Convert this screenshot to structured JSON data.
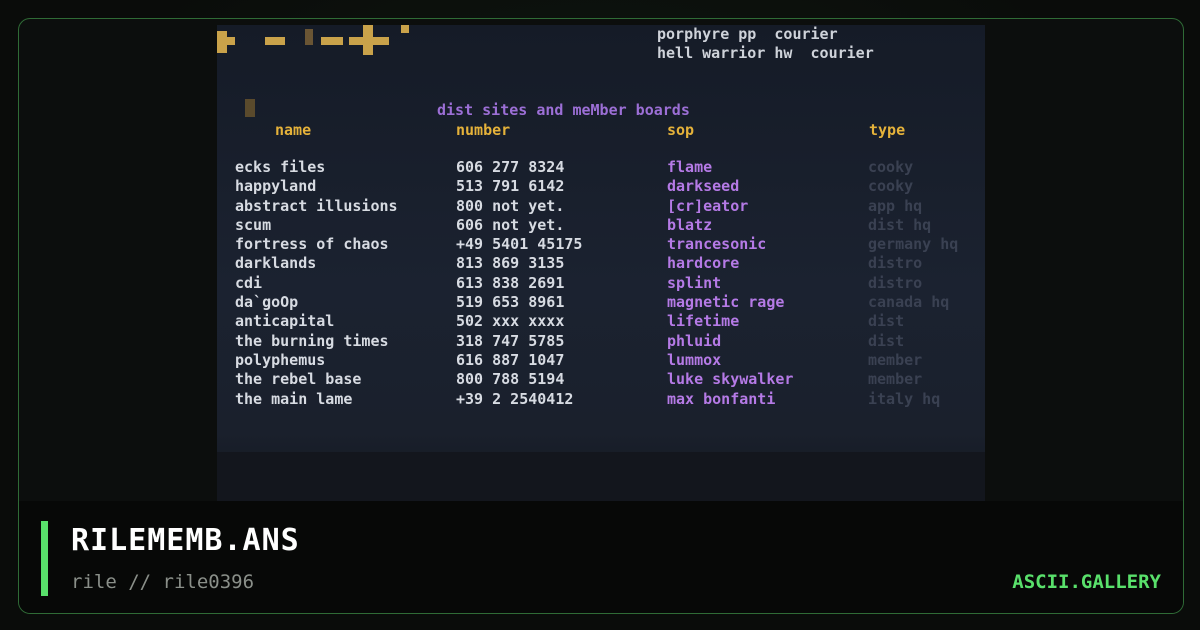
{
  "art": {
    "courier_lines": [
      "porphyre pp  courier",
      "hell warrior hw  courier"
    ],
    "heading": "dist sites and meMber boards",
    "columns": {
      "name": "name",
      "number": "number",
      "sysop": "sop",
      "type": "type"
    },
    "rows": [
      {
        "name": "ecks files",
        "number": "606 277 8324",
        "sysop": "flame",
        "type": "cooky"
      },
      {
        "name": "happyland",
        "number": "513 791 6142",
        "sysop": "darkseed",
        "type": "cooky"
      },
      {
        "name": "abstract illusions",
        "number": "800 not yet.",
        "sysop": "[cr]eator",
        "type": "app hq"
      },
      {
        "name": "scum",
        "number": "606 not yet.",
        "sysop": "blatz",
        "type": "dist hq"
      },
      {
        "name": "fortress of chaos",
        "number": "+49 5401 45175",
        "sysop": "trancesonic",
        "type": "germany hq"
      },
      {
        "name": "darklands",
        "number": "813 869 3135",
        "sysop": "hardcore",
        "type": "distro"
      },
      {
        "name": "cdi",
        "number": "613 838 2691",
        "sysop": "splint",
        "type": "distro"
      },
      {
        "name": "da`goOp",
        "number": "519 653 8961",
        "sysop": "magnetic rage",
        "type": "canada hq"
      },
      {
        "name": "anticapital",
        "number": "502 xxx xxxx",
        "sysop": "lifetime",
        "type": "dist"
      },
      {
        "name": "the burning times",
        "number": "318 747 5785",
        "sysop": "phluid",
        "type": "dist"
      },
      {
        "name": "polyphemus",
        "number": "616 887 1047",
        "sysop": "lummox",
        "type": "member"
      },
      {
        "name": "the rebel base",
        "number": "800 788 5194",
        "sysop": "luke skywalker",
        "type": "member"
      },
      {
        "name": "the main lame",
        "number": "+39 2 2540412",
        "sysop": "max bonfanti",
        "type": "italy hq"
      }
    ]
  },
  "footer": {
    "file_name": "RILEMEMB.ANS",
    "byline": "rile // rile0396",
    "brand": "ASCII.GALLERY"
  },
  "colors": {
    "accent": "#59e06b",
    "card_border": "#2f6b36",
    "ansi_gold": "#c9a24a",
    "ansi_purple": "#b57ae6",
    "ansi_white": "#d7dbe2"
  }
}
